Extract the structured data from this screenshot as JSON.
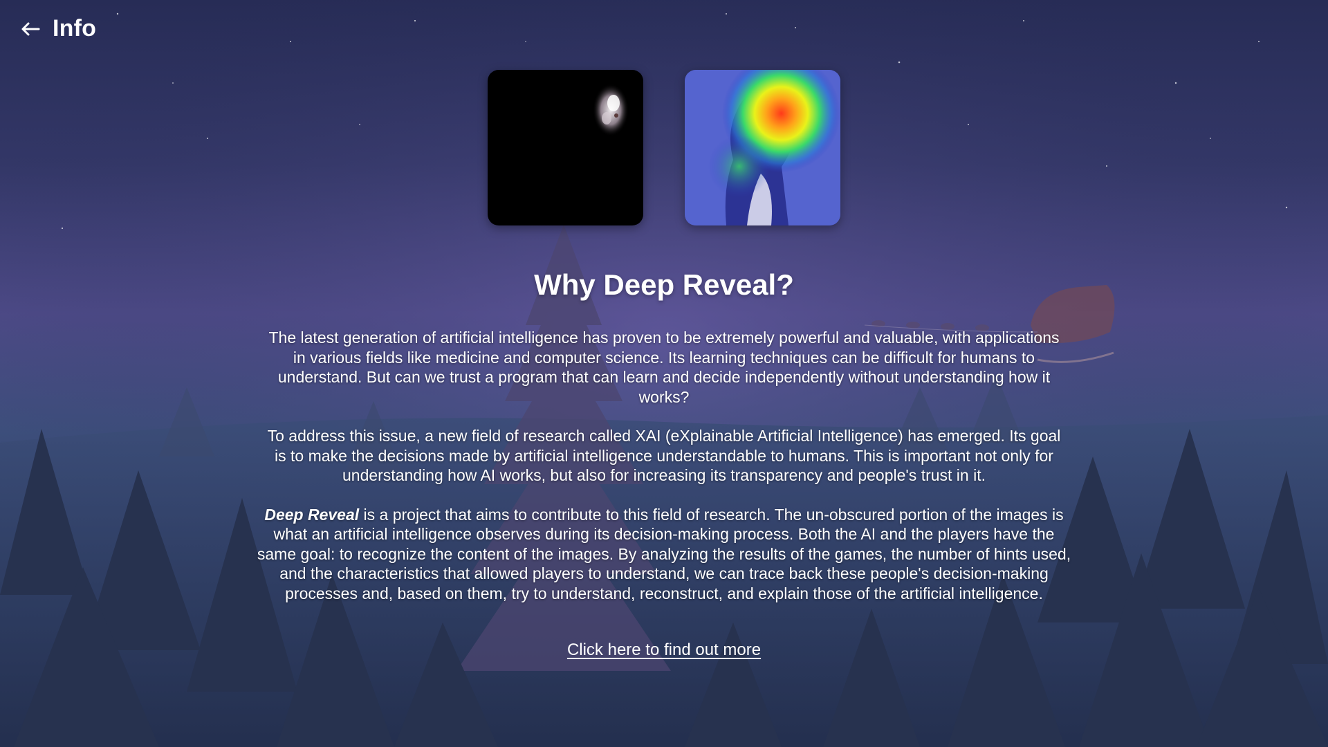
{
  "header": {
    "back_icon": "arrow-left-icon",
    "title": "Info"
  },
  "images": [
    {
      "name": "masked-dog-image",
      "description_icon": "revealed-fragment"
    },
    {
      "name": "heatmap-dog-image",
      "description_icon": "saliency-heatmap"
    }
  ],
  "main": {
    "title": "Why Deep Reveal?",
    "paragraph1": "The latest generation of artificial intelligence has proven to be extremely powerful and valuable, with applications in various fields like medicine and computer science. Its learning techniques can be difficult for humans to understand. But can we trust a program that can learn and decide independently without understanding how it works?",
    "paragraph2": "To address this issue, a new field of research called XAI (eXplainable Artificial Intelligence) has emerged. Its goal is to make the decisions made by artificial intelligence understandable to humans. This is important not only for understanding how AI works, but also for increasing its transparency and people's trust in it.",
    "paragraph3_emphasis": "Deep Reveal",
    "paragraph3_rest": " is a project that aims to contribute to this field of research. The un-obscured portion of the images is what an artificial intelligence observes during its decision-making process. Both the AI and the players have the same goal: to recognize the content of the images. By analyzing the results of the games, the number of hints used, and the characteristics that allowed players to understand, we can trace back these people's decision-making processes and, based on them, try to understand, reconstruct, and explain those of the artificial intelligence.",
    "link_label": "Click here to find out more"
  },
  "colors": {
    "sky_top": "#272c56",
    "sky_mid": "#4d4a87",
    "ground": "#232c4d",
    "text": "#ffffff"
  }
}
